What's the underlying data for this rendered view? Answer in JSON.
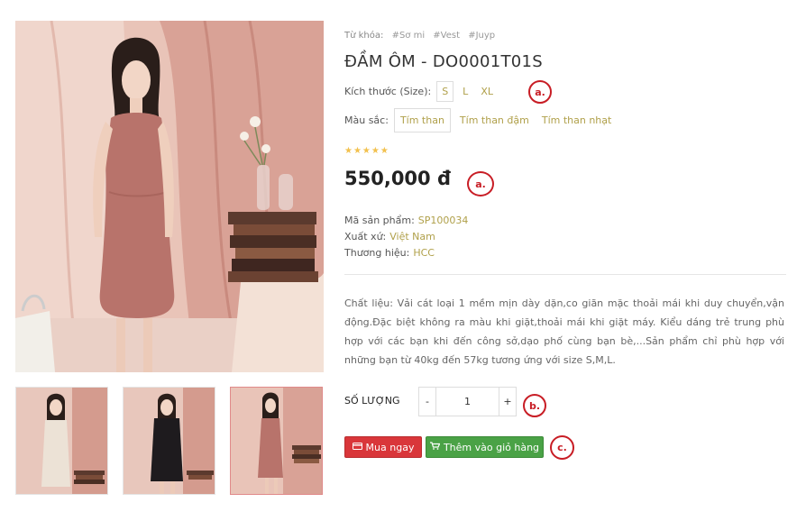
{
  "product": {
    "keywords_label": "Từ khóa:",
    "tags": [
      "#Sơ mi",
      "#Vest",
      "#Juyp"
    ],
    "title": "ĐẦM ÔM - DO0001T01S",
    "size_label": "Kích thước (Size):",
    "sizes": [
      "S",
      "L",
      "XL"
    ],
    "selected_size": "S",
    "color_label": "Màu sắc:",
    "colors": [
      "Tím than",
      "Tím than đậm",
      "Tím than nhạt"
    ],
    "selected_color": "Tím than",
    "rating_stars": "★★★★★",
    "rating_value": 5,
    "price": "550,000 đ",
    "sku_label": "Mã sản phẩm:",
    "sku": "SP100034",
    "origin_label": "Xuất xứ:",
    "origin": "Việt Nam",
    "brand_label": "Thương hiệu:",
    "brand": "HCC",
    "description": "Chất liệu: Vải cát loại 1 mềm mịn dày dặn,co giãn mặc thoải mái khi duy chuyển,vận động.Đặc biệt không ra màu khi giặt,thoải mái khi giặt máy. Kiểu dáng trẻ trung phù hợp với các bạn khi đến công sở,dạo phố cùng bạn bè,...Sản phẩm chỉ phù hợp với những bạn từ 40kg đến 57kg tương ứng với size S,M,L."
  },
  "quantity": {
    "label": "SỐ LƯỢNG",
    "minus": "-",
    "value": "1",
    "plus": "+"
  },
  "actions": {
    "buy_now": "Mua ngay",
    "add_to_cart": "Thêm vào giỏ hàng"
  },
  "annotations": [
    "a.",
    "a.",
    "b.",
    "c."
  ],
  "colors": {
    "accent_gold": "#b0a04a",
    "buy_red": "#d9363a",
    "cart_green": "#4aa246",
    "annotation_red": "#c81d25",
    "backdrop_pink": "#d9a296",
    "dress_pink": "#b8736b"
  }
}
